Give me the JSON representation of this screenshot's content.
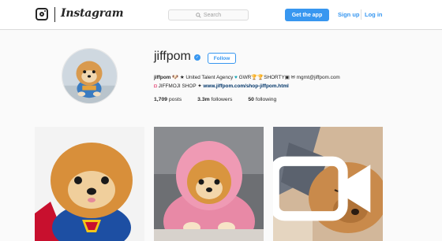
{
  "header": {
    "brand": "Instagram",
    "search_placeholder": "Search",
    "get_app_label": "Get the app",
    "signup_label": "Sign up",
    "login_label": "Log in"
  },
  "profile": {
    "username": "jiffpom",
    "follow_label": "Follow",
    "bio": {
      "handle": "jiffpom",
      "line1_text": " ★ United Talent Agency ",
      "gwr": "GWR",
      "shorty": "SHORTY",
      "email": "mgmt@jiffpom.com",
      "shop": "JIFFMOJI SHOP ✦",
      "url": "www.jiffpom.com/shop-jiffpom.html"
    },
    "stats": {
      "posts_count": "1,709",
      "posts_label": "posts",
      "followers_count": "3.3m",
      "followers_label": "followers",
      "following_count": "50",
      "following_label": "following"
    }
  },
  "icons": {
    "logo": "instagram-camera-icon",
    "search": "search-icon",
    "verified": "verified-badge-icon",
    "video": "video-camera-icon"
  },
  "colors": {
    "accent": "#3897f0",
    "link": "#003569",
    "border": "#dbdbdb",
    "background": "#fafafa"
  }
}
